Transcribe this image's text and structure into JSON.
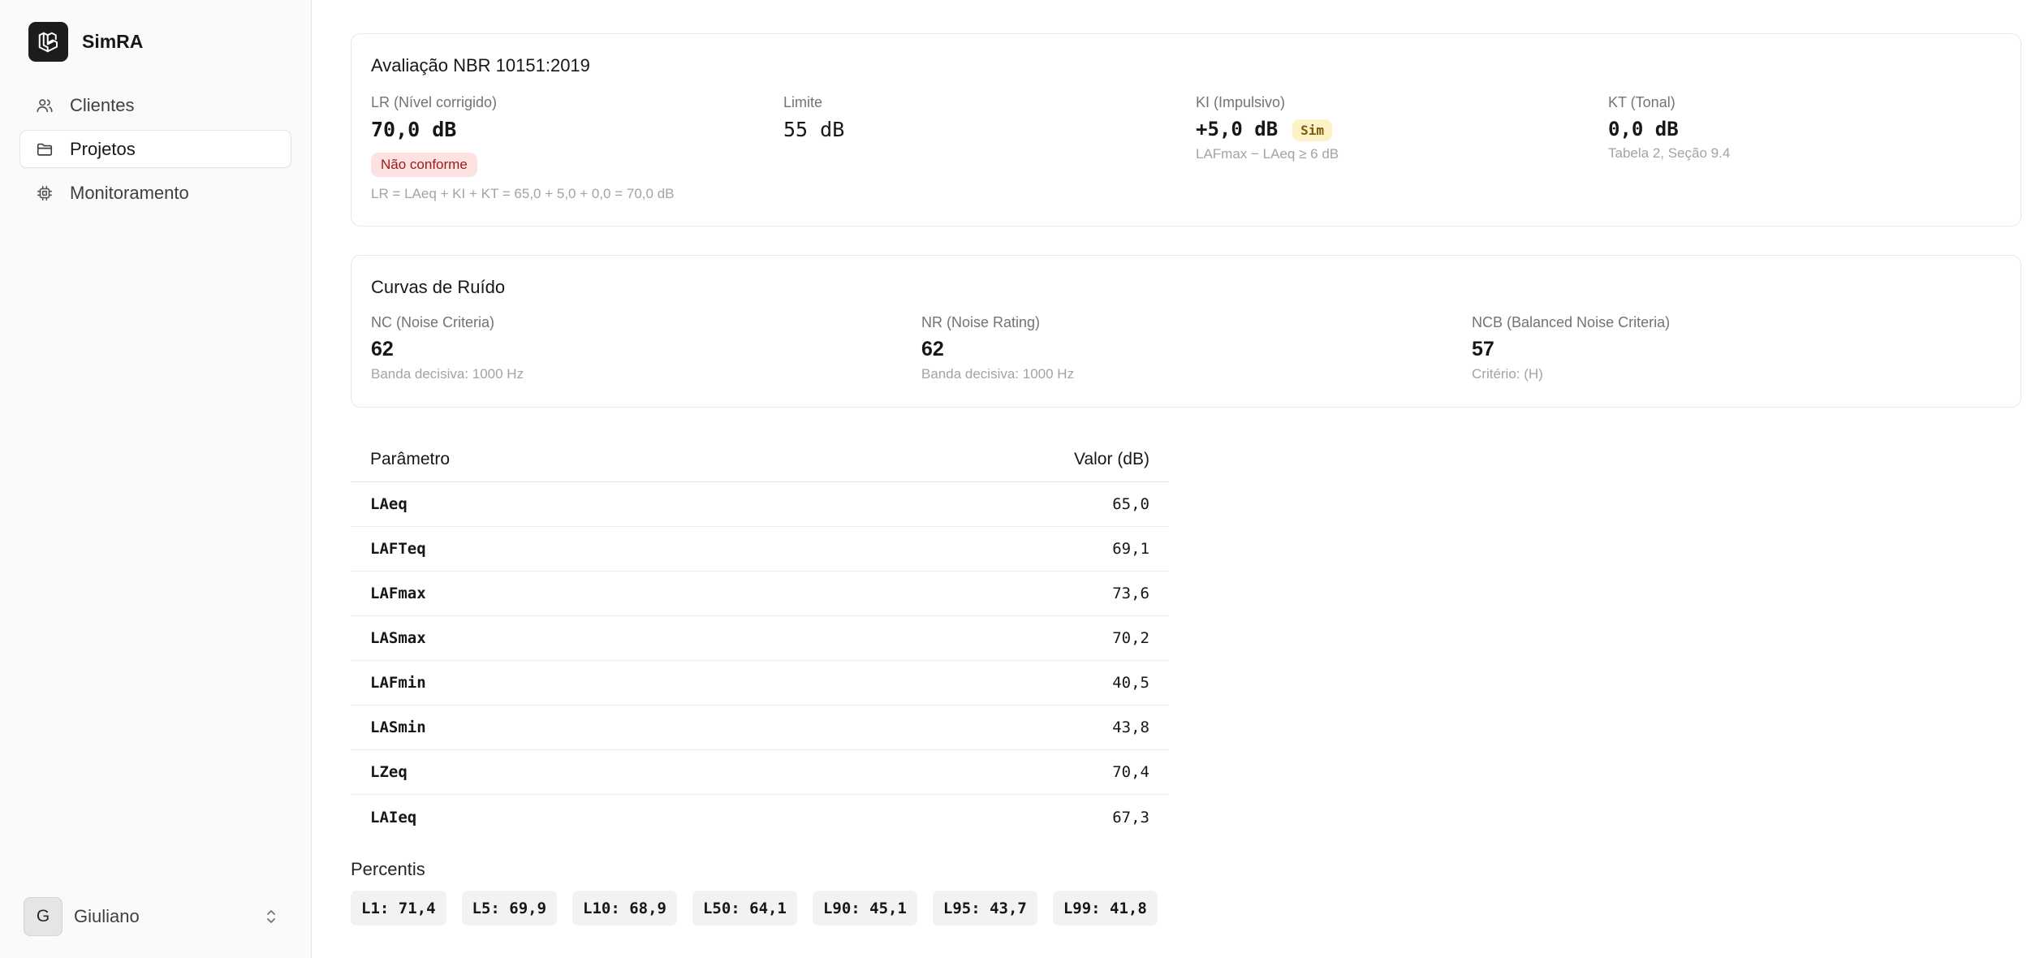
{
  "app": {
    "name": "SimRA"
  },
  "sidebar": {
    "items": [
      {
        "label": "Clientes",
        "icon": "users-icon",
        "active": false
      },
      {
        "label": "Projetos",
        "icon": "folder-icon",
        "active": true
      },
      {
        "label": "Monitoramento",
        "icon": "cpu-icon",
        "active": false
      }
    ],
    "user": {
      "initial": "G",
      "name": "Giuliano"
    }
  },
  "nbr_card": {
    "title": "Avaliação NBR 10151:2019",
    "lr": {
      "label": "LR (Nível corrigido)",
      "value": "70,0 dB",
      "status": "Não conforme"
    },
    "limite": {
      "label": "Limite",
      "value": "55 dB"
    },
    "ki": {
      "label": "KI (Impulsivo)",
      "value": "+5,0 dB",
      "badge": "Sim",
      "note": "LAFmax − LAeq ≥ 6 dB"
    },
    "kt": {
      "label": "KT (Tonal)",
      "value": "0,0 dB",
      "note": "Tabela 2, Seção 9.4"
    },
    "formula": "LR = LAeq + KI + KT = 65,0 + 5,0 + 0,0 = 70,0 dB"
  },
  "curves_card": {
    "title": "Curvas de Ruído",
    "nc": {
      "label": "NC (Noise Criteria)",
      "value": "62",
      "note": "Banda decisiva: 1000 Hz"
    },
    "nr": {
      "label": "NR (Noise Rating)",
      "value": "62",
      "note": "Banda decisiva: 1000 Hz"
    },
    "ncb": {
      "label": "NCB (Balanced Noise Criteria)",
      "value": "57",
      "note": "Critério: (H)"
    }
  },
  "param_table": {
    "headers": {
      "name": "Parâmetro",
      "value": "Valor (dB)"
    },
    "rows": [
      {
        "name": "LAeq",
        "value": "65,0"
      },
      {
        "name": "LAFTeq",
        "value": "69,1"
      },
      {
        "name": "LAFmax",
        "value": "73,6"
      },
      {
        "name": "LASmax",
        "value": "70,2"
      },
      {
        "name": "LAFmin",
        "value": "40,5"
      },
      {
        "name": "LASmin",
        "value": "43,8"
      },
      {
        "name": "LZeq",
        "value": "70,4"
      },
      {
        "name": "LAIeq",
        "value": "67,3"
      }
    ]
  },
  "percentis": {
    "title": "Percentis",
    "items": [
      "L1: 71,4",
      "L5: 69,9",
      "L10: 68,9",
      "L50: 64,1",
      "L90: 45,1",
      "L95: 43,7",
      "L99: 41,8"
    ]
  },
  "colors": {
    "badge_nonconform_bg": "#fde2e2",
    "badge_nonconform_text": "#991b1b",
    "badge_sim_bg": "#fcf2c5",
    "brand_logo_bg": "#1c1c1c"
  }
}
